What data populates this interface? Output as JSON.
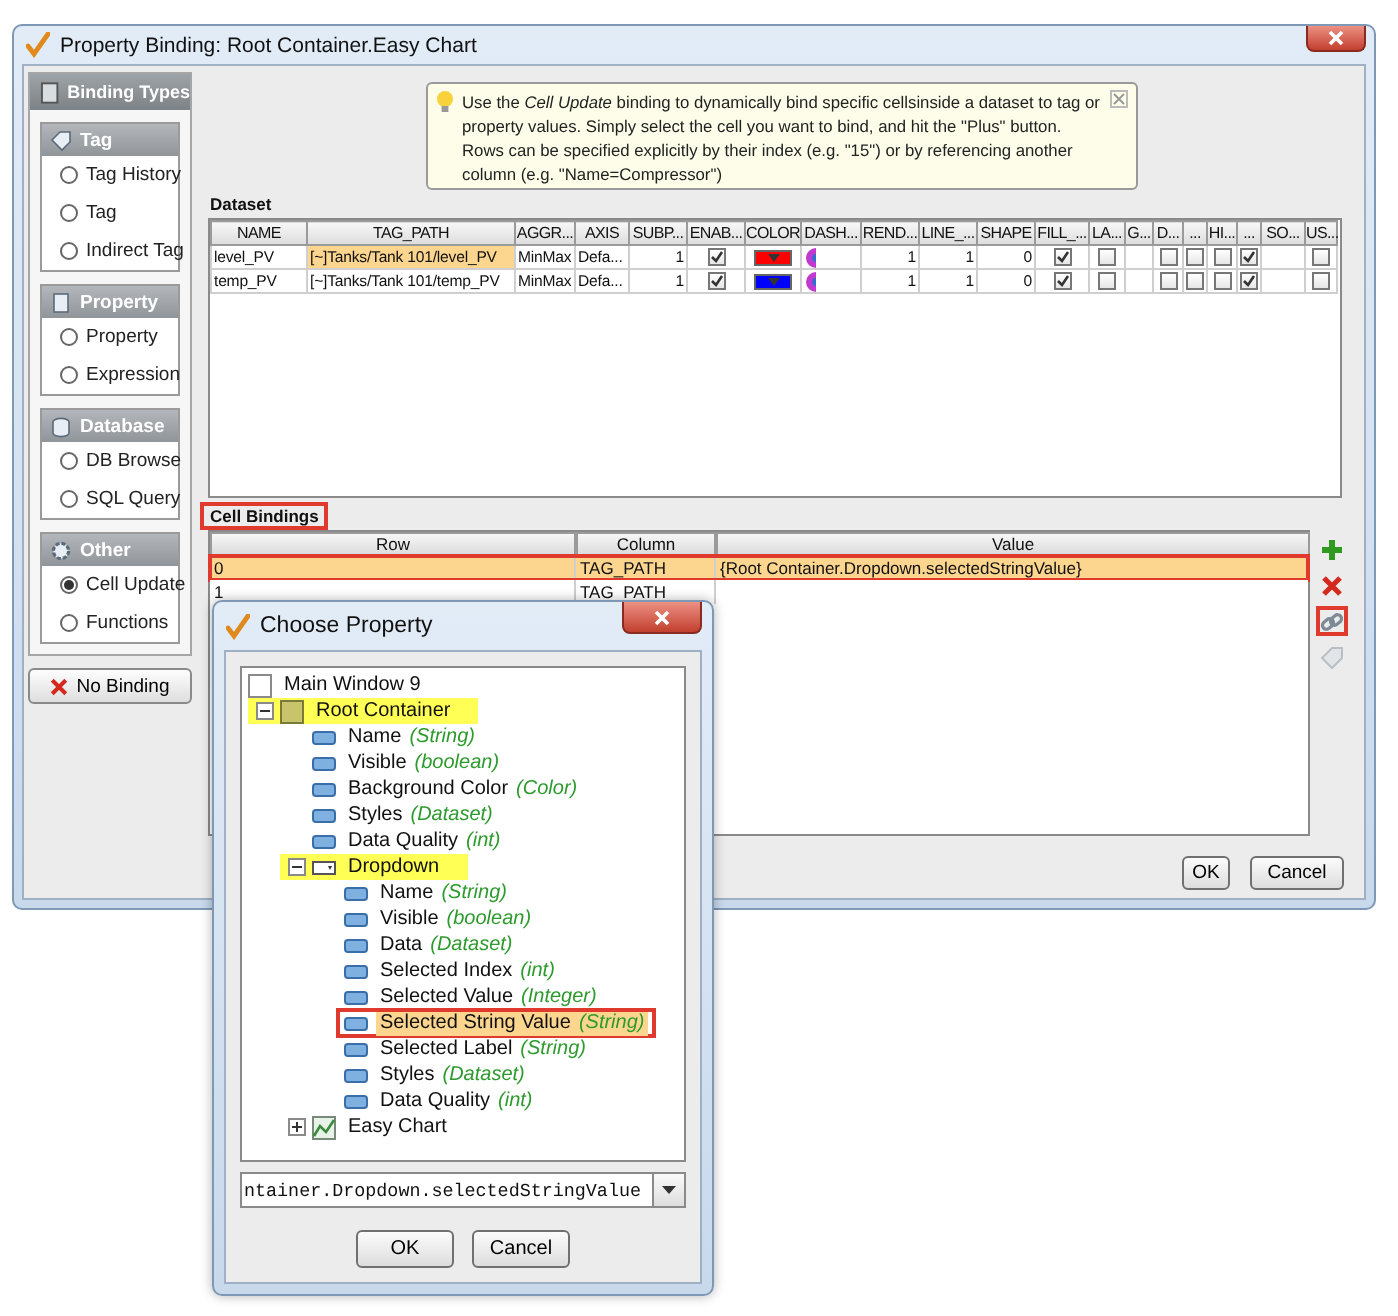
{
  "main_window": {
    "title": "Property Binding: Root Container.Easy Chart",
    "sidebar": {
      "header": "Binding Types",
      "groups": [
        {
          "title": "Tag",
          "kind": "tag",
          "options": [
            {
              "label": "Tag History",
              "selected": false
            },
            {
              "label": "Tag",
              "selected": false
            },
            {
              "label": "Indirect Tag",
              "selected": false
            }
          ]
        },
        {
          "title": "Property",
          "kind": "property",
          "options": [
            {
              "label": "Property",
              "selected": false
            },
            {
              "label": "Expression",
              "selected": false
            }
          ]
        },
        {
          "title": "Database",
          "kind": "database",
          "options": [
            {
              "label": "DB Browse",
              "selected": false
            },
            {
              "label": "SQL Query",
              "selected": false
            }
          ]
        },
        {
          "title": "Other",
          "kind": "other",
          "options": [
            {
              "label": "Cell Update",
              "selected": true
            },
            {
              "label": "Functions",
              "selected": false
            }
          ]
        }
      ],
      "no_binding": "No Binding"
    },
    "tip": "Use the *Cell Update* binding to dynamically bind specific cellsinside a dataset to tag or property values. Simply select the cell you want to bind, and hit the \"Plus\" button. Rows can be specified explicitly by their index (e.g. \"15\") or by referencing another column (e.g. \"Name=Compressor\")",
    "dataset": {
      "title": "Dataset",
      "columns": [
        "NAME",
        "TAG_PATH",
        "AGGR...",
        "AXIS",
        "SUBP...",
        "ENAB...",
        "COLOR",
        "DASH...",
        "REND...",
        "LINE_...",
        "SHAPE",
        "FILL_...",
        "LA...",
        "G...",
        "D...",
        "...",
        "HI...",
        "...",
        "SO...",
        "US..."
      ],
      "rows": [
        {
          "cells": [
            {
              "kind": "text",
              "text": "level_PV",
              "selected": false
            },
            {
              "kind": "text",
              "text": "[~]Tanks/Tank 101/level_PV",
              "selected": true
            },
            {
              "kind": "text",
              "text": "MinMax",
              "selected": false
            },
            {
              "kind": "text",
              "text": "Defa...",
              "selected": false
            },
            {
              "kind": "num",
              "text": "1"
            },
            {
              "kind": "check",
              "checked": true
            },
            {
              "kind": "color",
              "color": "#ff0000"
            },
            {
              "kind": "dash"
            },
            {
              "kind": "num",
              "text": "1"
            },
            {
              "kind": "num",
              "text": "1"
            },
            {
              "kind": "num",
              "text": "0"
            },
            {
              "kind": "check",
              "checked": true
            },
            {
              "kind": "check",
              "checked": false
            },
            {
              "kind": "blank"
            },
            {
              "kind": "check",
              "checked": false
            },
            {
              "kind": "check",
              "checked": false
            },
            {
              "kind": "check",
              "checked": false
            },
            {
              "kind": "check",
              "checked": true
            },
            {
              "kind": "blank"
            },
            {
              "kind": "check",
              "checked": false
            }
          ]
        },
        {
          "cells": [
            {
              "kind": "text",
              "text": "temp_PV",
              "selected": false
            },
            {
              "kind": "text",
              "text": "[~]Tanks/Tank 101/temp_PV",
              "selected": false
            },
            {
              "kind": "text",
              "text": "MinMax",
              "selected": false
            },
            {
              "kind": "text",
              "text": "Defa...",
              "selected": false
            },
            {
              "kind": "num",
              "text": "1"
            },
            {
              "kind": "check",
              "checked": true
            },
            {
              "kind": "color",
              "color": "#0000ff"
            },
            {
              "kind": "dash"
            },
            {
              "kind": "num",
              "text": "1"
            },
            {
              "kind": "num",
              "text": "1"
            },
            {
              "kind": "num",
              "text": "0"
            },
            {
              "kind": "check",
              "checked": true
            },
            {
              "kind": "check",
              "checked": false
            },
            {
              "kind": "blank"
            },
            {
              "kind": "check",
              "checked": false
            },
            {
              "kind": "check",
              "checked": false
            },
            {
              "kind": "check",
              "checked": false
            },
            {
              "kind": "check",
              "checked": true
            },
            {
              "kind": "blank"
            },
            {
              "kind": "check",
              "checked": false
            }
          ]
        }
      ]
    },
    "cell_bindings": {
      "title": "Cell Bindings",
      "outlined": true,
      "columns": [
        "Row",
        "Column",
        "Value"
      ],
      "rows": [
        {
          "row": "0",
          "column": "TAG_PATH",
          "value": "{Root Container.Dropdown.selectedStringValue}",
          "selected": true,
          "outlined": true
        },
        {
          "row": "1",
          "column": "TAG_PATH",
          "selected": false,
          "outlined": false
        }
      ],
      "tools": [
        {
          "kind": "add",
          "disabled": false,
          "outlined": false
        },
        {
          "kind": "remove",
          "disabled": false,
          "outlined": false
        },
        {
          "kind": "link",
          "disabled": false,
          "outlined": true
        },
        {
          "kind": "tag",
          "disabled": true,
          "outlined": false
        }
      ]
    },
    "buttons": [
      "OK",
      "Cancel"
    ]
  },
  "dialog": {
    "title": "Choose Property",
    "tree": [
      {
        "kind": "window",
        "name": "Main Window 9",
        "selected": false,
        "highlighted": false,
        "outlined": false
      },
      {
        "kind": "container",
        "name": "Root Container",
        "expanded": true,
        "selected": false,
        "highlighted": true,
        "outlined": false,
        "children": [
          {
            "kind": "property",
            "name": "Name",
            "type": "(String)",
            "selected": false,
            "highlighted": false,
            "outlined": false
          },
          {
            "kind": "property",
            "name": "Visible",
            "type": "(boolean)",
            "selected": false,
            "highlighted": false,
            "outlined": false
          },
          {
            "kind": "property",
            "name": "Background Color",
            "type": "(Color)",
            "selected": false,
            "highlighted": false,
            "outlined": false
          },
          {
            "kind": "property",
            "name": "Styles",
            "type": "(Dataset)",
            "selected": false,
            "highlighted": false,
            "outlined": false
          },
          {
            "kind": "property",
            "name": "Data Quality",
            "type": "(int)",
            "selected": false,
            "highlighted": false,
            "outlined": false
          },
          {
            "kind": "dropdown",
            "name": "Dropdown",
            "expanded": true,
            "selected": false,
            "highlighted": true,
            "outlined": false,
            "children": [
              {
                "kind": "property",
                "name": "Name",
                "type": "(String)",
                "selected": false,
                "highlighted": false,
                "outlined": false
              },
              {
                "kind": "property",
                "name": "Visible",
                "type": "(boolean)",
                "selected": false,
                "highlighted": false,
                "outlined": false
              },
              {
                "kind": "property",
                "name": "Data",
                "type": "(Dataset)",
                "selected": false,
                "highlighted": false,
                "outlined": false
              },
              {
                "kind": "property",
                "name": "Selected Index",
                "type": "(int)",
                "selected": false,
                "highlighted": false,
                "outlined": false
              },
              {
                "kind": "property",
                "name": "Selected Value",
                "type": "(Integer)",
                "selected": false,
                "highlighted": false,
                "outlined": false
              },
              {
                "kind": "property",
                "name": "Selected String Value",
                "type": "(String)",
                "selected": true,
                "highlighted": false,
                "outlined": true
              },
              {
                "kind": "property",
                "name": "Selected Label",
                "type": "(String)",
                "selected": false,
                "highlighted": false,
                "outlined": false
              },
              {
                "kind": "property",
                "name": "Styles",
                "type": "(Dataset)",
                "selected": false,
                "highlighted": false,
                "outlined": false
              },
              {
                "kind": "property",
                "name": "Data Quality",
                "type": "(int)",
                "selected": false,
                "highlighted": false,
                "outlined": false
              }
            ]
          },
          {
            "kind": "chart",
            "name": "Easy Chart",
            "expanded": false,
            "selected": false,
            "highlighted": false,
            "outlined": false
          }
        ]
      }
    ],
    "path": "ntainer.Dropdown.selectedStringValue",
    "buttons": [
      "OK",
      "Cancel"
    ]
  }
}
